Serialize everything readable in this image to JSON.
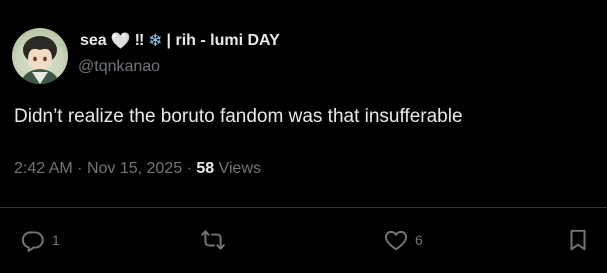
{
  "user": {
    "display_name_parts": [
      "sea",
      "🤍",
      "‼",
      "❄",
      "| rih - lumi DAY"
    ],
    "handle": "@tqnkanao",
    "avatar_icon": "avatar-anime-character"
  },
  "tweet": {
    "text": "Didn’t realize the boruto fandom was that insufferable",
    "time": "2:42 AM",
    "date": "Nov 15, 2025",
    "separator": "·",
    "views_count": "58",
    "views_label": "Views"
  },
  "actions": {
    "reply_count": "1",
    "retweet_count": "",
    "like_count": "6",
    "icons": [
      "reply-icon",
      "retweet-icon",
      "like-icon",
      "bookmark-icon"
    ]
  },
  "colors": {
    "background": "#000000",
    "text_primary": "#e7e9ea",
    "text_secondary": "#71767b",
    "divider": "#2f3336"
  }
}
